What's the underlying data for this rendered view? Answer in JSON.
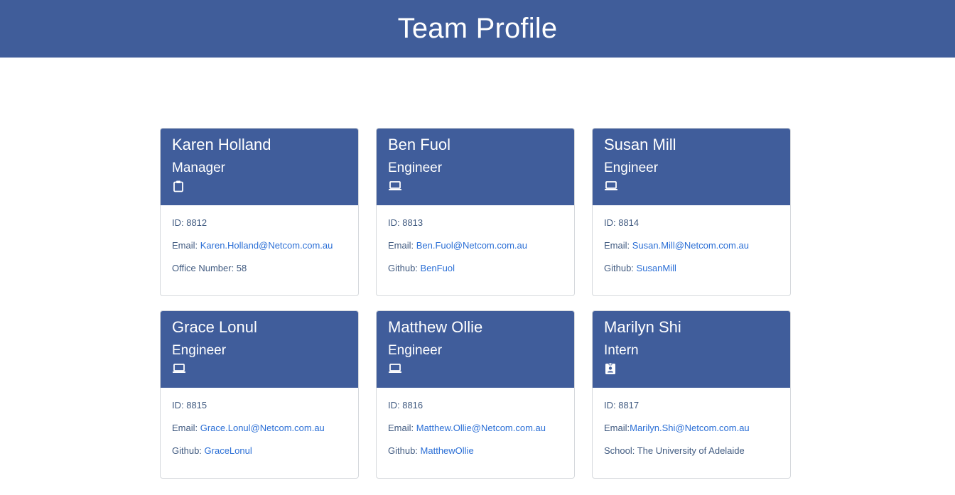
{
  "header": {
    "title": "Team Profile"
  },
  "members": [
    {
      "name": "Karen Holland",
      "role": "Manager",
      "icon": "clipboard-icon",
      "id_label": "ID: 8812",
      "email_label": "Email: ",
      "email": "Karen.Holland@Netcom.com.au",
      "extra_label": "Office Number: 58",
      "extra_link": ""
    },
    {
      "name": "Ben Fuol",
      "role": "Engineer",
      "icon": "laptop-icon",
      "id_label": "ID: 8813",
      "email_label": "Email: ",
      "email": "Ben.Fuol@Netcom.com.au",
      "extra_label": "Github: ",
      "extra_link": "BenFuol"
    },
    {
      "name": "Susan Mill",
      "role": "Engineer",
      "icon": "laptop-icon",
      "id_label": "ID: 8814",
      "email_label": "Email: ",
      "email": "Susan.Mill@Netcom.com.au",
      "extra_label": "Github: ",
      "extra_link": "SusanMill"
    },
    {
      "name": "Grace Lonul",
      "role": "Engineer",
      "icon": "laptop-icon",
      "id_label": "ID: 8815",
      "email_label": "Email: ",
      "email": "Grace.Lonul@Netcom.com.au",
      "extra_label": "Github: ",
      "extra_link": "GraceLonul"
    },
    {
      "name": "Matthew Ollie",
      "role": "Engineer",
      "icon": "laptop-icon",
      "id_label": "ID: 8816",
      "email_label": "Email: ",
      "email": "Matthew.Ollie@Netcom.com.au",
      "extra_label": "Github: ",
      "extra_link": "MatthewOllie"
    },
    {
      "name": "Marilyn Shi",
      "role": "Intern",
      "icon": "student-badge-icon",
      "id_label": "ID: 8817",
      "email_label": "Email:",
      "email": "Marilyn.Shi@Netcom.com.au",
      "extra_label": "School: The University of Adelaide",
      "extra_link": ""
    }
  ],
  "colors": {
    "header_bg": "#405d9a",
    "link": "#2b6fd6",
    "body_text": "#405a80"
  }
}
